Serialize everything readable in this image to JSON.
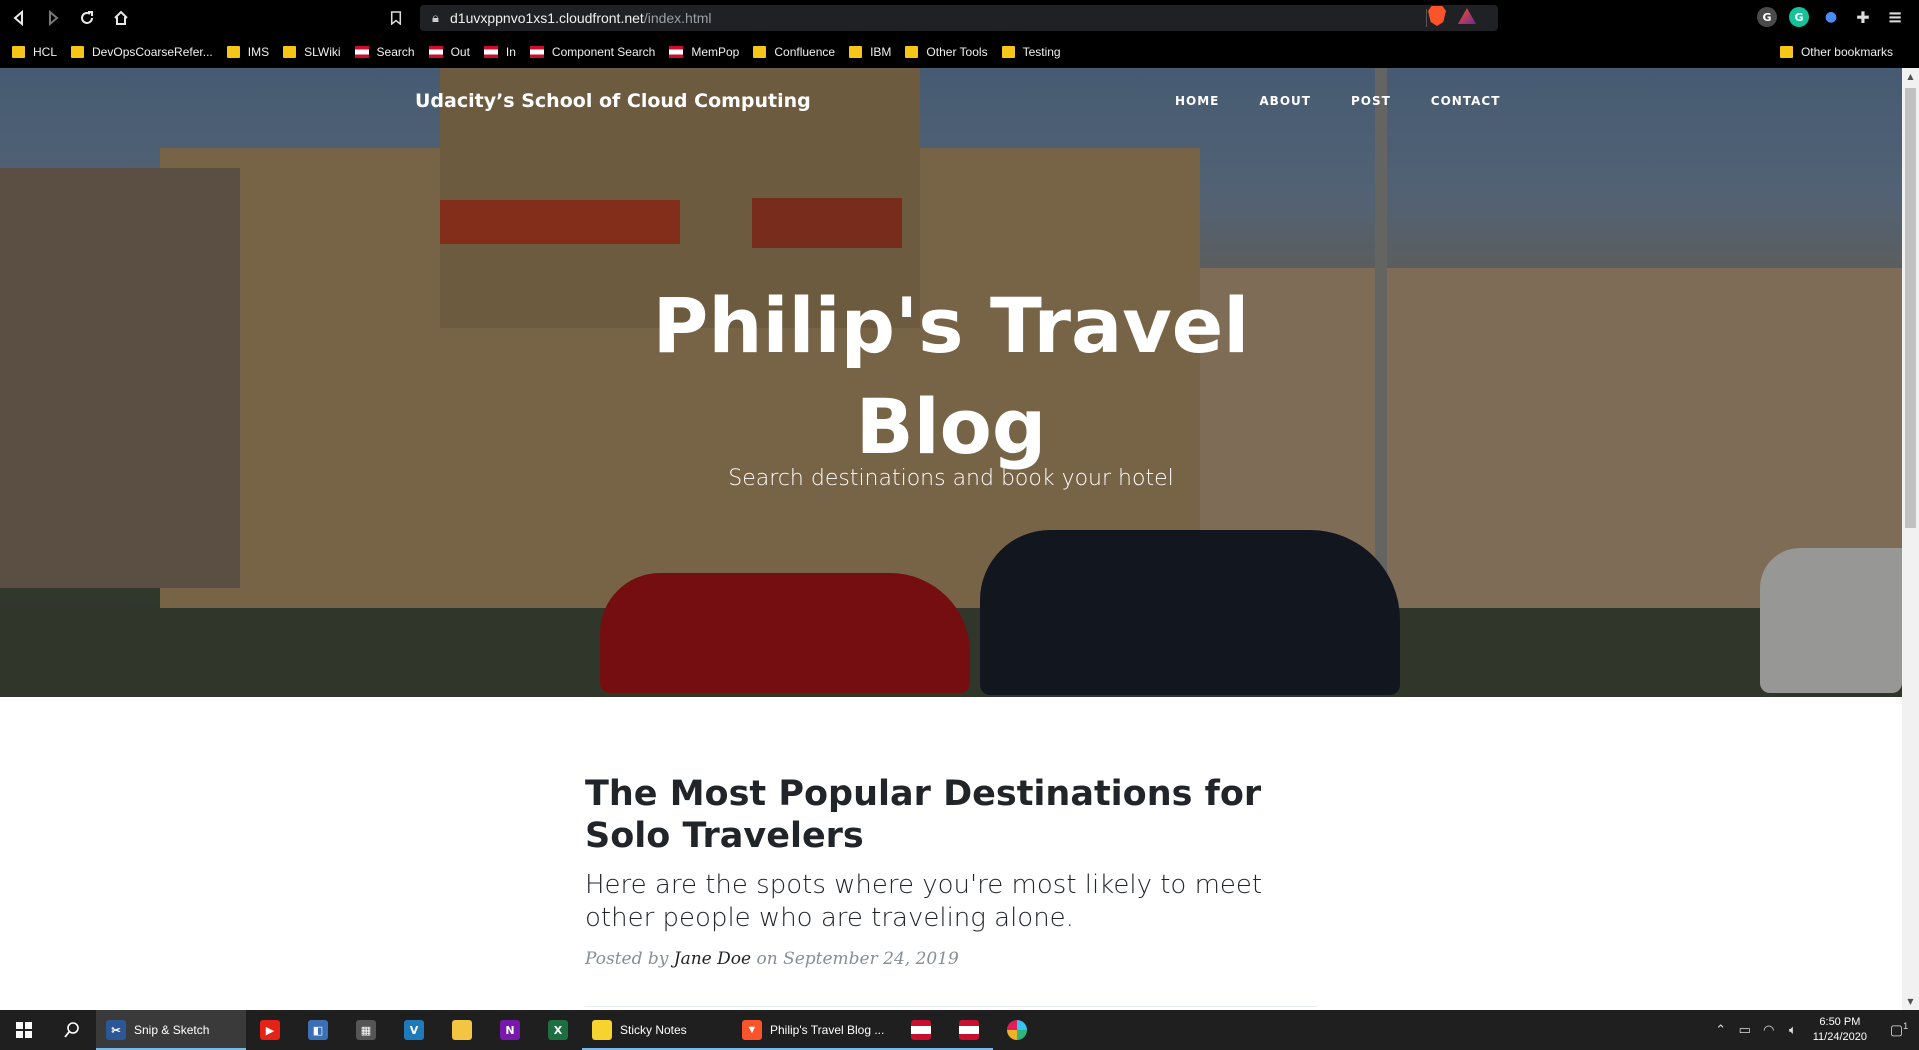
{
  "browser": {
    "url_host": "d1uvxppnvo1xs1.cloudfront.net",
    "url_path": "/index.html",
    "bookmarks": [
      {
        "label": "HCL",
        "type": "folder"
      },
      {
        "label": "DevOpsCoarseRefer...",
        "type": "folder"
      },
      {
        "label": "IMS",
        "type": "folder"
      },
      {
        "label": "SLWiki",
        "type": "folder"
      },
      {
        "label": "Search",
        "type": "flag"
      },
      {
        "label": "Out",
        "type": "flag"
      },
      {
        "label": "In",
        "type": "flag"
      },
      {
        "label": "Component Search",
        "type": "flag"
      },
      {
        "label": "MemPop",
        "type": "flag"
      },
      {
        "label": "Confluence",
        "type": "folder"
      },
      {
        "label": "IBM",
        "type": "folder"
      },
      {
        "label": "Other Tools",
        "type": "folder"
      },
      {
        "label": "Testing",
        "type": "folder"
      }
    ],
    "other_bookmarks": "Other bookmarks"
  },
  "site": {
    "brand": "Udacity’s School of Cloud Computing",
    "nav": [
      "HOME",
      "ABOUT",
      "POST",
      "CONTACT"
    ],
    "hero_title": "Philip's Travel Blog",
    "hero_subtitle": "Search destinations and book your hotel"
  },
  "post": {
    "title": "The Most Popular Destinations for Solo Travelers",
    "subtitle": "Here are the spots where you're most likely to meet other people who are traveling alone.",
    "meta_prefix": "Posted by",
    "author": "Jane Doe",
    "meta_on": "on",
    "date": "September 24, 2019"
  },
  "taskbar": {
    "apps": [
      {
        "label": "Snip & Sketch",
        "active": true
      },
      {
        "label": "Sticky Notes",
        "active": false
      },
      {
        "label": "Philip's Travel Blog ...",
        "active": false
      }
    ],
    "time": "6:50 PM",
    "date": "11/24/2020",
    "notification_count": "1"
  },
  "colors": {
    "brand_text": "#ffffff",
    "heading": "#212529",
    "meta": "#868e96",
    "taskbar": "#1f1f1f"
  }
}
